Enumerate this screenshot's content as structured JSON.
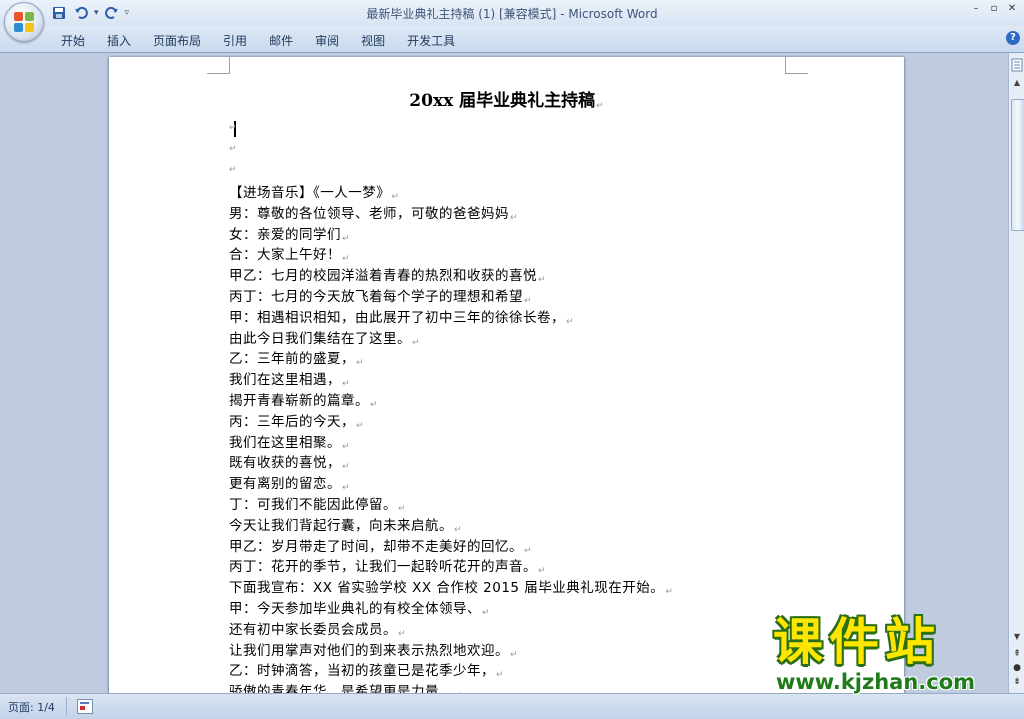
{
  "window": {
    "title_doc": "最新毕业典礼主持稿 (1) [兼容模式]",
    "title_sep": " - ",
    "title_app": "Microsoft Word"
  },
  "ribbon": {
    "tabs": [
      "开始",
      "插入",
      "页面布局",
      "引用",
      "邮件",
      "审阅",
      "视图",
      "开发工具"
    ]
  },
  "document": {
    "title": "20xx 届毕业典礼主持稿",
    "lines": [
      "【进场音乐】《一人一梦》",
      "男：尊敬的各位领导、老师，可敬的爸爸妈妈",
      "女：亲爱的同学们",
      "合：大家上午好！",
      "甲乙：七月的校园洋溢着青春的热烈和收获的喜悦",
      "丙丁：七月的今天放飞着每个学子的理想和希望",
      "甲：相遇相识相知，由此展开了初中三年的徐徐长卷，",
      "由此今日我们集结在了这里。",
      "乙：三年前的盛夏，",
      "我们在这里相遇，",
      "揭开青春崭新的篇章。",
      "丙：三年后的今天，",
      "我们在这里相聚。",
      "既有收获的喜悦，",
      "更有离别的留恋。",
      "丁：可我们不能因此停留。",
      "今天让我们背起行囊，向未来启航。",
      "甲乙：岁月带走了时间，却带不走美好的回忆。",
      "丙丁：花开的季节，让我们一起聆听花开的声音。",
      "下面我宣布：XX 省实验学校 XX 合作校 2015 届毕业典礼现在开始。",
      "甲：今天参加毕业典礼的有校全体领导、",
      "还有初中家长委员会成员。",
      "让我们用掌声对他们的到来表示热烈地欢迎。",
      "乙：时钟滴答，当初的孩童已是花季少年，",
      "骄傲的青春年华，是希望更是力量，"
    ]
  },
  "status": {
    "page": "页面: 1/4"
  },
  "watermark": {
    "main": "课件站",
    "url": "www.kjzhan.com"
  },
  "colors": {
    "title_text": "#3e5478",
    "tab_text": "#1e395b",
    "watermark_fill": "#ffe600",
    "watermark_outline": "#2a6e16"
  }
}
